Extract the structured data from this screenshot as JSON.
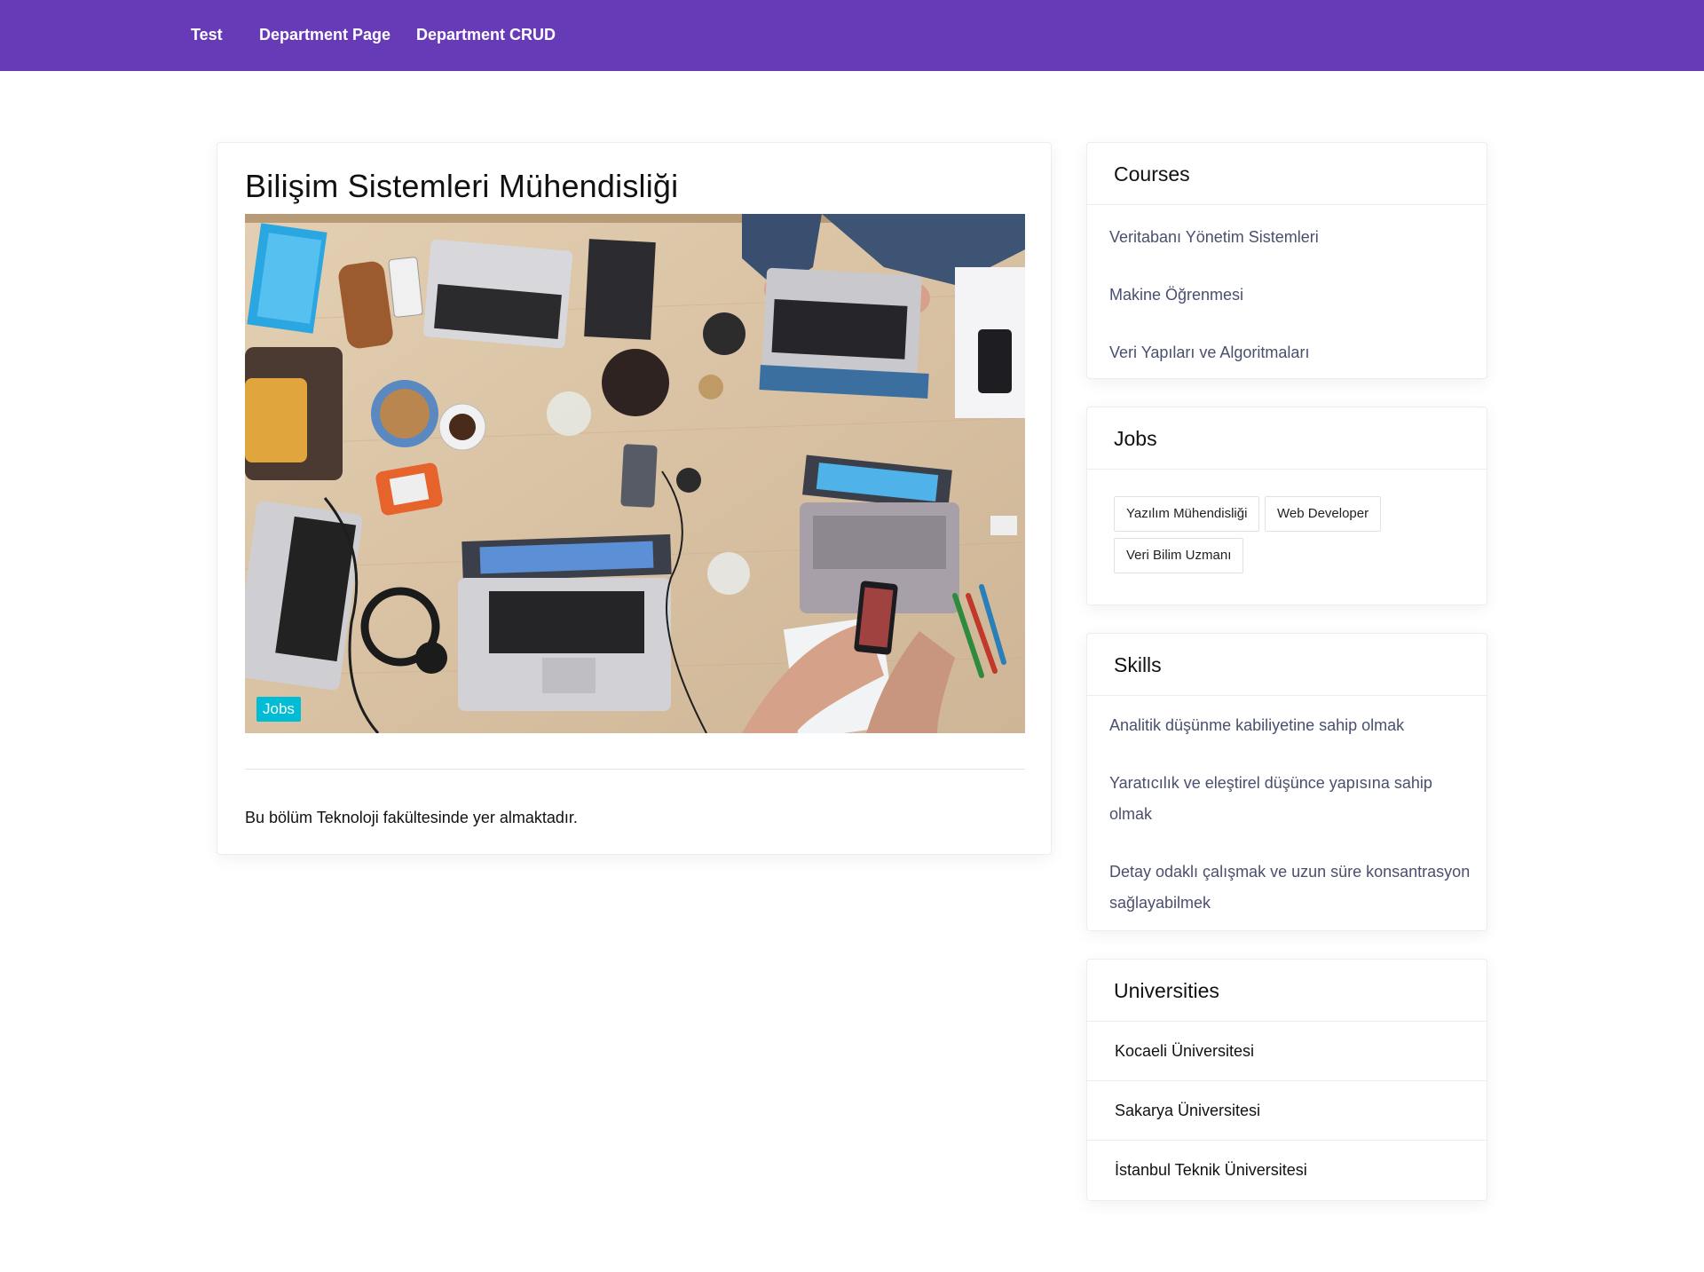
{
  "nav": {
    "items": [
      "Test",
      "Department Page",
      "Department CRUD"
    ]
  },
  "department": {
    "title": "Bilişim Sistemleri Mühendisliği",
    "image_tag": "Jobs",
    "description": "Bu bölüm Teknoloji fakültesinde yer almaktadır."
  },
  "courses": {
    "title": "Courses",
    "items": [
      "Veritabanı Yönetim Sistemleri",
      "Makine Öğrenmesi",
      "Veri Yapıları ve Algoritmaları"
    ]
  },
  "jobs": {
    "title": "Jobs",
    "items": [
      "Yazılım Mühendisliği",
      "Web Developer",
      "Veri Bilim Uzmanı"
    ]
  },
  "skills": {
    "title": "Skills",
    "items": [
      "Analitik düşünme kabiliyetine sahip olmak",
      "Yaratıcılık ve eleştirel düşünce yapısına sahip olmak",
      "Detay odaklı çalışmak ve uzun süre konsantrasyon sağlayabilmek"
    ]
  },
  "universities": {
    "title": "Universities",
    "items": [
      "Kocaeli Üniversitesi",
      "Sakarya Üniversitesi",
      "İstanbul Teknik Üniversitesi"
    ]
  },
  "colors": {
    "navbar": "#673ab7",
    "tag": "#00bcd4",
    "link": "#4a4f6e"
  }
}
